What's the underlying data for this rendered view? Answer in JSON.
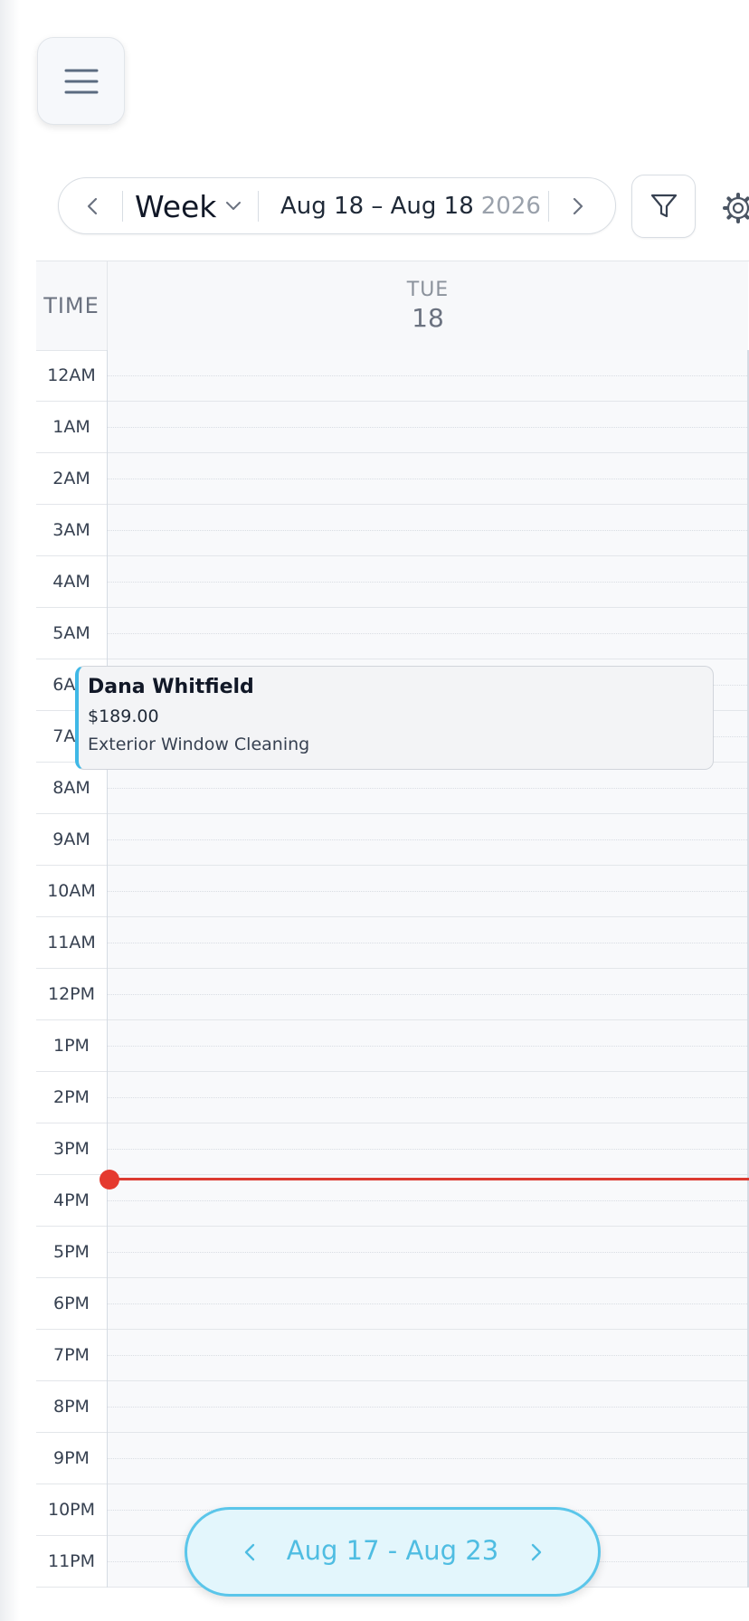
{
  "toolbar": {
    "view_label": "Week",
    "range": "Aug 18 – Aug 18",
    "year": "2026"
  },
  "calendar": {
    "time_header": "TIME",
    "day_name": "TUE",
    "day_number": "18",
    "hours": [
      "12AM",
      "1AM",
      "2AM",
      "3AM",
      "4AM",
      "5AM",
      "6AM",
      "7AM",
      "8AM",
      "9AM",
      "10AM",
      "11AM",
      "12PM",
      "1PM",
      "2PM",
      "3PM",
      "4PM",
      "5PM",
      "6PM",
      "7PM",
      "8PM",
      "9PM",
      "10PM",
      "11PM"
    ]
  },
  "event": {
    "customer": "Dana Whitfield",
    "price": "$189.00",
    "service": "Exterior Window Cleaning",
    "accent_color": "#3fb8e6"
  },
  "week_nav": {
    "label": "Aug 17 - Aug 23"
  },
  "colors": {
    "now_line": "#dc3b31",
    "week_pill_border": "#5bc6ea",
    "week_pill_text": "#4fbde2"
  }
}
